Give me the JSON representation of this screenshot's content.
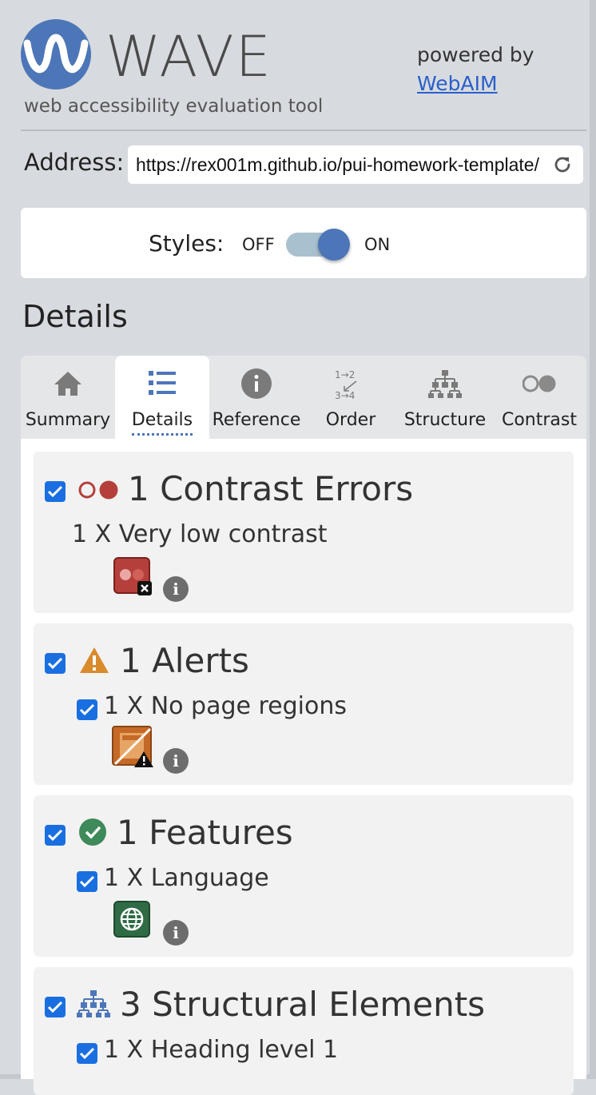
{
  "header": {
    "title": "WAVE",
    "subtitle": "web accessibility evaluation tool",
    "powered_by": "powered by",
    "powered_link": "WebAIM"
  },
  "address": {
    "label": "Address:",
    "value": "https://rex001m.github.io/pui-homework-template/"
  },
  "styles_toggle": {
    "label": "Styles:",
    "off": "OFF",
    "on": "ON",
    "state": "on"
  },
  "details_heading": "Details",
  "tabs": [
    {
      "label": "Summary",
      "icon": "home-icon"
    },
    {
      "label": "Details",
      "icon": "list-icon",
      "active": true
    },
    {
      "label": "Reference",
      "icon": "info-icon"
    },
    {
      "label": "Order",
      "icon": "order-icon"
    },
    {
      "label": "Structure",
      "icon": "structure-icon"
    },
    {
      "label": "Contrast",
      "icon": "contrast-icon"
    }
  ],
  "categories": [
    {
      "title": "1 Contrast Errors",
      "icon": "contrast-error-icon",
      "items": [
        {
          "label": "1 X Very low contrast",
          "icon": "very-low-contrast-icon"
        }
      ]
    },
    {
      "title": "1 Alerts",
      "icon": "alert-icon",
      "items": [
        {
          "label": "1 X No page regions",
          "icon": "no-page-regions-icon"
        }
      ]
    },
    {
      "title": "1 Features",
      "icon": "feature-icon",
      "items": [
        {
          "label": "1 X Language",
          "icon": "language-icon"
        }
      ]
    },
    {
      "title": "3 Structural Elements",
      "icon": "structure-icon",
      "items": [
        {
          "label": "1 X Heading level 1",
          "icon": "heading-icon"
        }
      ]
    }
  ],
  "colors": {
    "brand_blue": "#4d76b8",
    "error_red": "#b5403b",
    "alert_orange": "#d98a2b",
    "feature_green": "#3f8a5a",
    "checkbox_blue": "#1a6fe0"
  }
}
